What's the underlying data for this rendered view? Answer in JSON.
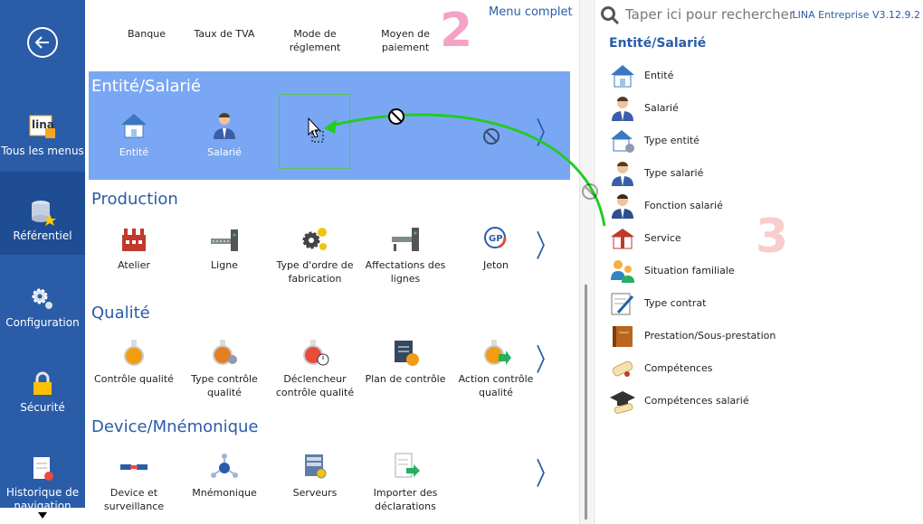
{
  "nav": {
    "items": [
      {
        "label": "Tous les menus",
        "icon": "lina-logo-icon"
      },
      {
        "label": "Référentiel",
        "icon": "database-star-icon",
        "active": true
      },
      {
        "label": "Configuration",
        "icon": "gears-icon"
      },
      {
        "label": "Sécurité",
        "icon": "padlock-icon"
      },
      {
        "label": "Historique de navigation",
        "icon": "document-history-icon"
      }
    ]
  },
  "top": {
    "items": [
      "Banque",
      "Taux de TVA",
      "Mode de réglement",
      "Moyen de paiement"
    ],
    "menu_complet": "Menu complet",
    "step_badge": "2"
  },
  "sections": [
    {
      "title": "Entité/Salarié",
      "tiles": [
        "Entité",
        "Salarié"
      ]
    },
    {
      "title": "Production",
      "tiles": [
        "Atelier",
        "Ligne",
        "Type d'ordre de fabrication",
        "Affectations des lignes",
        "Jeton"
      ]
    },
    {
      "title": "Qualité",
      "tiles": [
        "Contrôle qualité",
        "Type contrôle qualité",
        "Déclencheur contrôle qualité",
        "Plan de contrôle",
        "Action contrôle qualité"
      ]
    },
    {
      "title": "Device/Mnémonique",
      "tiles": [
        "Device et surveillance",
        "Mnémonique",
        "Serveurs",
        "Importer des déclarations"
      ]
    }
  ],
  "chevron": "〉",
  "right": {
    "search_placeholder": "Taper ici pour rechercher",
    "app": "LINA Entreprise  V3.12.9.2",
    "title": "Entité/Salarié",
    "step_badge": "3",
    "items": [
      "Entité",
      "Salarié",
      "Type entité",
      "Type salarié",
      "Fonction salarié",
      "Service",
      "Situation familiale",
      "Type contrat",
      "Prestation/Sous-prestation",
      "Compétences",
      "Compétences salarié"
    ]
  },
  "colors": {
    "nav_bg": "#2a5ca8",
    "selected_section": "#7aa7f4",
    "accent_text": "#2a5ca8",
    "drag_line": "#22cc22",
    "badge2": "#f4a3c6",
    "badge3": "#f9cdcd"
  }
}
